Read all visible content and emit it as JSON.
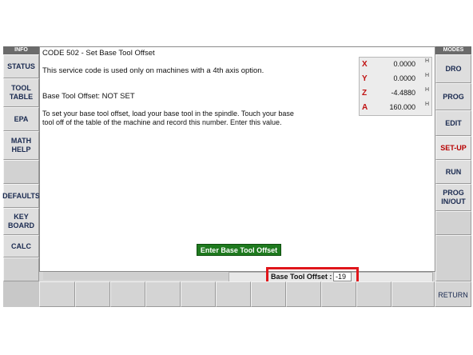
{
  "modes_header": "MODES",
  "info_header": "INFO",
  "left_buttons": [
    {
      "label": "STATUS"
    },
    {
      "label": "TOOL\nTABLE"
    },
    {
      "label": "EPA"
    },
    {
      "label": "MATH\nHELP"
    },
    {
      "label": ""
    },
    {
      "label": "DEFAULTS"
    },
    {
      "label": "KEY\nBOARD"
    },
    {
      "label": "CALC"
    },
    {
      "label": ""
    }
  ],
  "right_buttons": [
    {
      "label": "DRO"
    },
    {
      "label": "PROG"
    },
    {
      "label": "EDIT"
    },
    {
      "label": "SET-UP",
      "active": true
    },
    {
      "label": "RUN"
    },
    {
      "label": "PROG\nIN/OUT"
    },
    {
      "label": ""
    },
    {
      "label": ""
    }
  ],
  "main": {
    "title": "CODE 502 - Set Base Tool Offset",
    "line1": "This service code is used only on machines with a 4th axis option.",
    "line2": "Base Tool Offset: NOT SET",
    "paragraph": "To set your base tool offset, load your base tool in the spindle.  Touch your base tool off of the table of the machine and record this number. Enter this value.",
    "enter_button": "Enter Base Tool Offset"
  },
  "axes": [
    {
      "letter": "X",
      "value": "0.0000",
      "unit": "H"
    },
    {
      "letter": "Y",
      "value": "0.0000",
      "unit": "H"
    },
    {
      "letter": "Z",
      "value": "-4.4880",
      "unit": "H"
    },
    {
      "letter": "A",
      "value": "160.000",
      "unit": "H"
    }
  ],
  "offset_input": {
    "label": "Base Tool Offset :",
    "value": "-19"
  },
  "bottom_buttons": [
    "",
    "",
    "",
    "",
    "",
    "",
    "",
    "",
    "",
    "",
    "",
    "RETURN"
  ],
  "colors": {
    "accent_red": "#e0161b",
    "active_mode": "#b80000",
    "enter_green": "#1e7a1e"
  }
}
